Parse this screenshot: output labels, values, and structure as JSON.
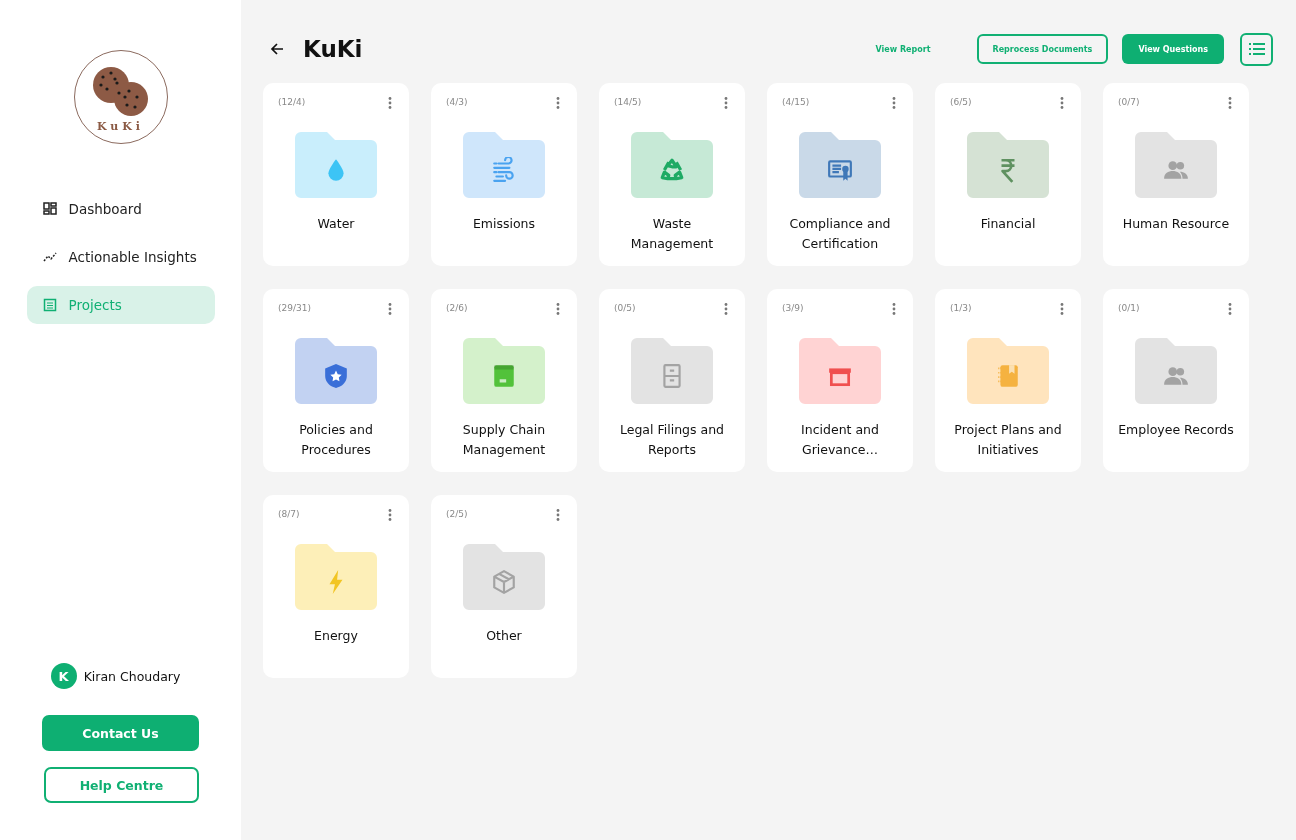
{
  "sidebar": {
    "logo": {
      "text": "KuKi"
    },
    "items": [
      {
        "label": "Dashboard",
        "selected": false
      },
      {
        "label": "Actionable Insights",
        "selected": false
      },
      {
        "label": "Projects",
        "selected": true
      }
    ],
    "user": {
      "initial": "K",
      "name": "Kiran Choudary"
    },
    "buttons": [
      {
        "label": "Contact Us",
        "kind": "filled"
      },
      {
        "label": "Help Centre",
        "kind": "outline"
      }
    ]
  },
  "header": {
    "title": "KuKi",
    "actions": [
      {
        "label": "View Report",
        "kind": "link"
      },
      {
        "label": "Reprocess Documents",
        "kind": "outline"
      },
      {
        "label": "View Questions",
        "kind": "filled"
      }
    ]
  },
  "folders": [
    {
      "count": "(12/4)",
      "name": "Water",
      "kind": "drop",
      "color": "#c9eefc"
    },
    {
      "count": "(4/3)",
      "name": "Emissions",
      "kind": "wind",
      "color": "#cfe6fb"
    },
    {
      "count": "(14/5)",
      "name": "Waste Management",
      "kind": "recycle",
      "color": "#c6e9d6"
    },
    {
      "count": "(4/15)",
      "name": "Compliance and Certification",
      "kind": "certificate",
      "color": "#c9d9e8"
    },
    {
      "count": "(6/5)",
      "name": "Financial",
      "kind": "rupee",
      "color": "#d5e2d4"
    },
    {
      "count": "(0/7)",
      "name": "Human Resource",
      "kind": "people",
      "color": "#e3e3e3"
    },
    {
      "count": "(29/31)",
      "name": "Policies and Procedures",
      "kind": "shield",
      "color": "#c2d2f2"
    },
    {
      "count": "(2/6)",
      "name": "Supply Chain Management",
      "kind": "box",
      "color": "#d4f1cb"
    },
    {
      "count": "(0/5)",
      "name": "Legal Filings and Reports",
      "kind": "cabinet",
      "color": "#e3e3e3"
    },
    {
      "count": "(3/9)",
      "name": "Incident and Grievance…",
      "kind": "archive",
      "color": "#ffd3d3"
    },
    {
      "count": "(1/3)",
      "name": "Project Plans and Initiatives",
      "kind": "notebook",
      "color": "#ffe4bd"
    },
    {
      "count": "(0/1)",
      "name": "Employee Records",
      "kind": "people",
      "color": "#e3e3e3"
    },
    {
      "count": "(8/7)",
      "name": "Energy",
      "kind": "bolt",
      "color": "#fdefb8"
    },
    {
      "count": "(2/5)",
      "name": "Other",
      "kind": "cube",
      "color": "#e3e3e3"
    }
  ]
}
